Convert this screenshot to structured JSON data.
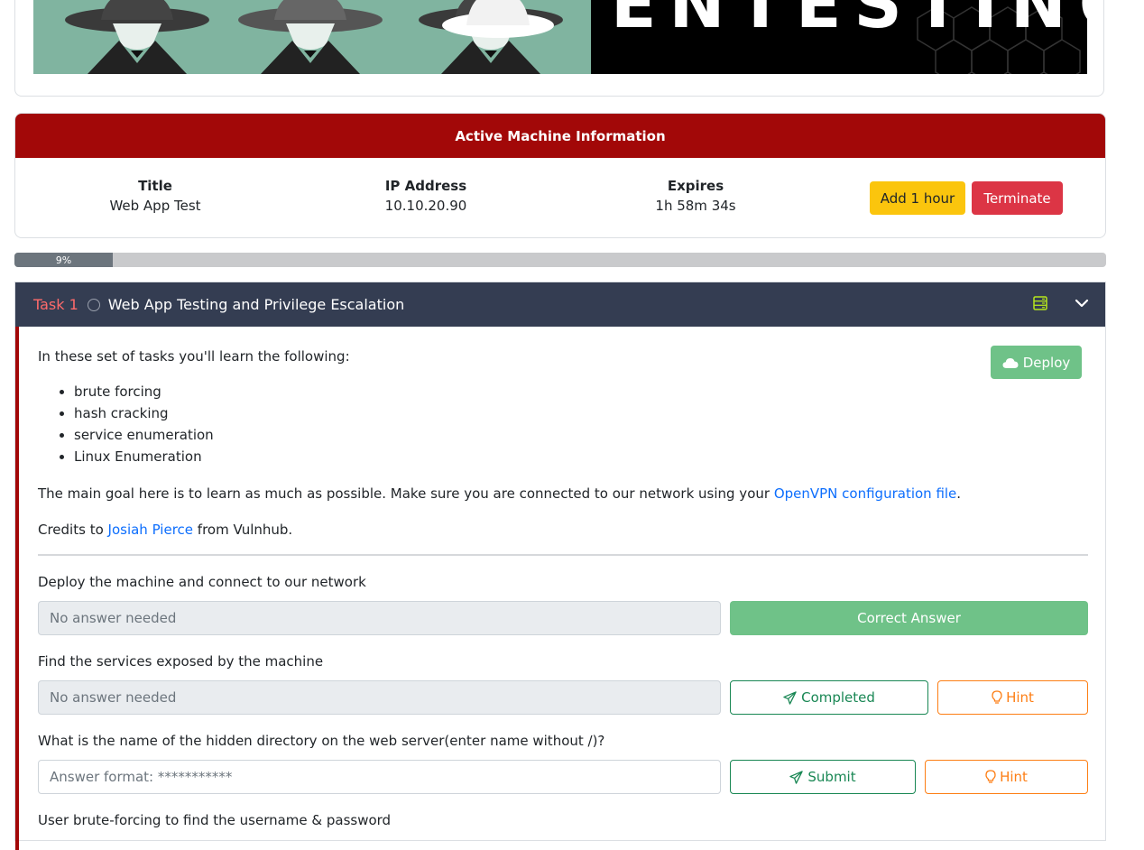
{
  "banner": {
    "text": "ENTESTING"
  },
  "machine": {
    "header": "Active Machine Information",
    "title_label": "Title",
    "title_value": "Web App Test",
    "ip_label": "IP Address",
    "ip_value": "10.10.20.90",
    "expires_label": "Expires",
    "expires_value": "1h 58m 34s",
    "add_hour_label": "Add 1 hour",
    "terminate_label": "Terminate"
  },
  "progress": {
    "label": "9%",
    "value": 0.09
  },
  "task": {
    "number": "Task 1",
    "title": "Web App Testing and Privilege Escalation",
    "deploy_label": "Deploy",
    "intro": "In these set of tasks you'll learn the following:",
    "skills": [
      "brute forcing",
      "hash cracking",
      "service enumeration",
      "Linux Enumeration"
    ],
    "goal_prefix": "The main goal here is to learn as much as possible. Make sure you are connected to our network using your ",
    "goal_link": "OpenVPN configuration file",
    "goal_suffix": ".",
    "credits_prefix": "Credits to ",
    "credits_link": "Josiah Pierce",
    "credits_suffix": " from Vulnhub."
  },
  "questions": [
    {
      "text": "Deploy the machine and connect to our network",
      "answer": "No answer needed",
      "button": "Correct Answer"
    },
    {
      "text": "Find the services exposed by the machine",
      "answer": "No answer needed",
      "button": "Completed",
      "hint": "Hint"
    },
    {
      "text": "What is the name of the hidden directory on the web server(enter name without /)?",
      "placeholder": "Answer format: ***********",
      "button": "Submit",
      "hint": "Hint"
    },
    {
      "text": "User brute-forcing to find the username & password"
    }
  ],
  "colors": {
    "accent_red": "#a20808",
    "task_header": "#343d52",
    "success": "#6fc288",
    "warning": "#fbc50d",
    "danger": "#dc3545"
  }
}
